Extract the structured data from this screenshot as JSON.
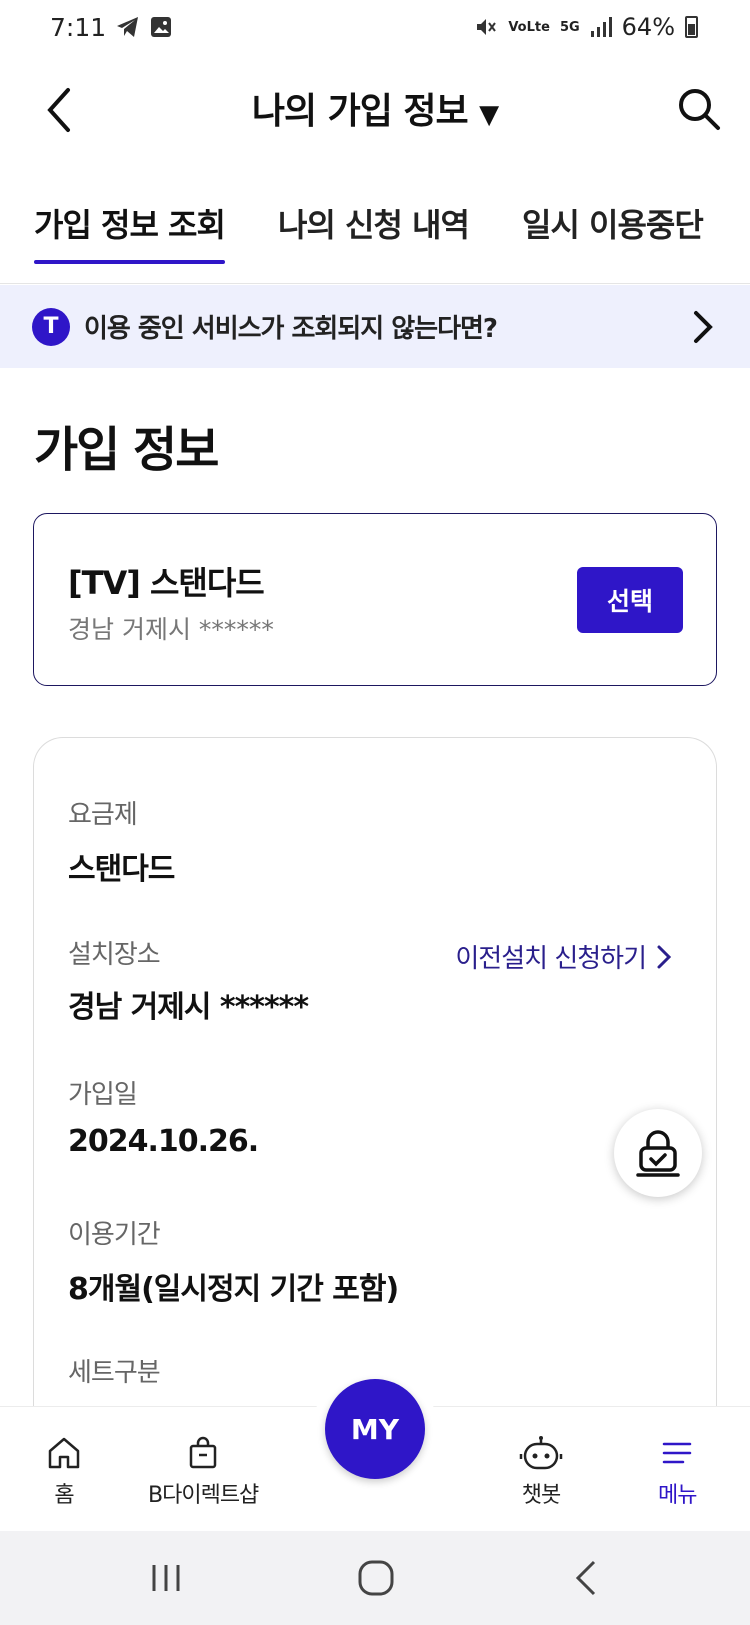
{
  "status_bar": {
    "time": "7:11",
    "network": "VoLte",
    "network_5g": "5G",
    "battery": "64%"
  },
  "header": {
    "title": "나의 가입 정보",
    "title_caret": "▼"
  },
  "tabs": [
    {
      "label": "가입 정보 조회",
      "active": true
    },
    {
      "label": "나의 신청 내역",
      "active": false
    },
    {
      "label": "일시 이용중단",
      "active": false
    }
  ],
  "banner": {
    "badge": "T",
    "text": "이용 중인 서비스가 조회되지 않는다면?"
  },
  "section_title": "가입 정보",
  "subscription": {
    "name": "[TV] 스탠다드",
    "address": "경남 거제시 ******",
    "select_label": "선택"
  },
  "details": {
    "plan_label": "요금제",
    "plan_value": "스탠다드",
    "location_label": "설치장소",
    "location_value": "경남 거제시 ******",
    "transfer_link": "이전설치 신청하기",
    "join_date_label": "가입일",
    "join_date_value": "2024.10.26.",
    "period_label": "이용기간",
    "period_value": "8개월(일시정지 기간 포함)",
    "set_label": "세트구분"
  },
  "bottom_nav": {
    "home": "홈",
    "shop": "B다이렉트샵",
    "my": "MY",
    "chatbot": "챗봇",
    "menu": "메뉴"
  },
  "colors": {
    "accent": "#2f16c8",
    "banner_bg": "#eef0fd",
    "card_border": "#1d1760"
  }
}
